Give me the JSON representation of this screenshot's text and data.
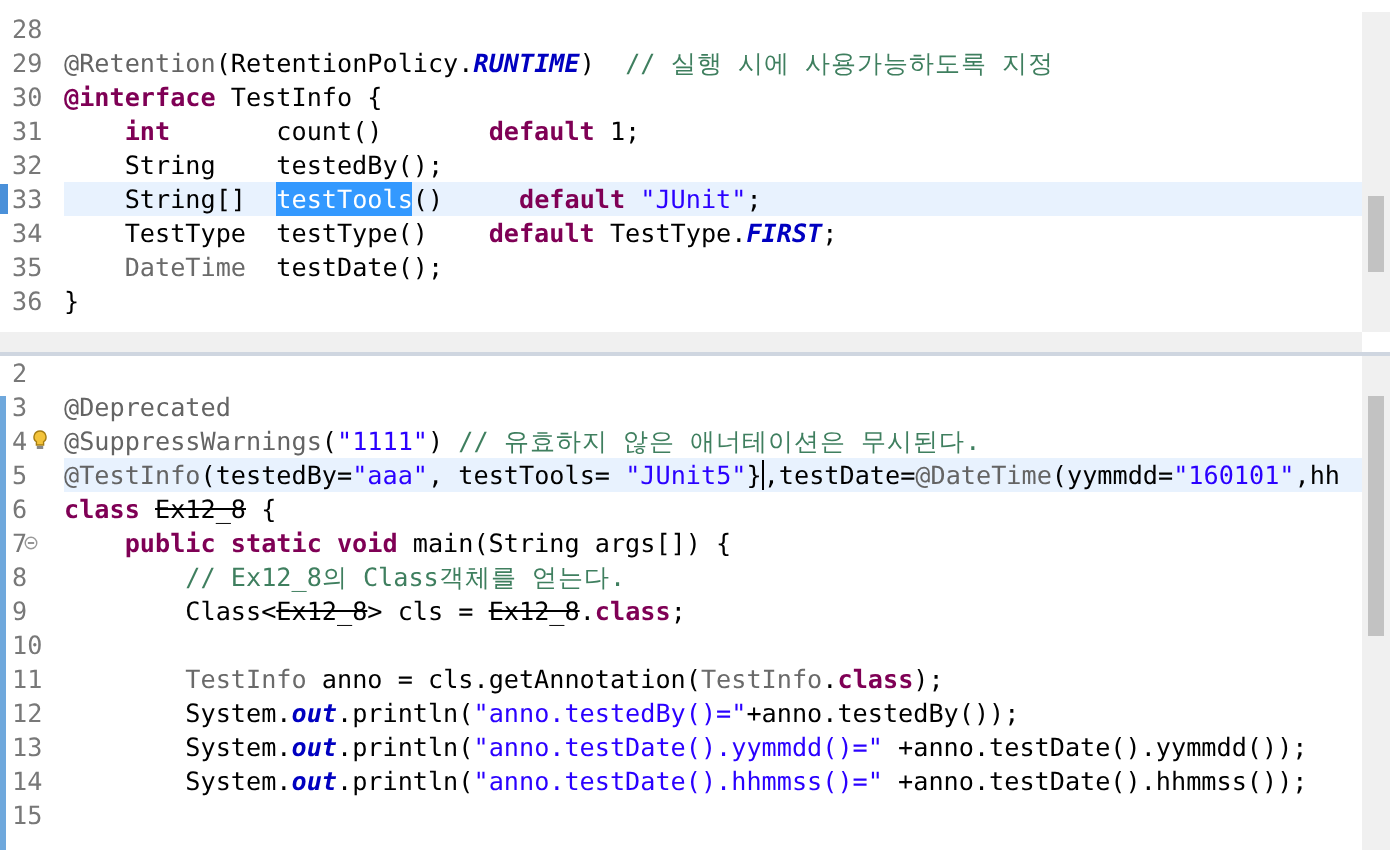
{
  "panes": [
    {
      "lines": [
        {
          "number": "28",
          "current": false
        },
        {
          "number": "29",
          "current": false,
          "tokens": [
            {
              "text": "@Retention",
              "kind": "annotation"
            },
            {
              "text": "(RetentionPolicy.",
              "kind": "plain"
            },
            {
              "text": "RUNTIME",
              "kind": "constant"
            },
            {
              "text": ")",
              "kind": "plain"
            },
            {
              "text": "  // 실행 시에 사용가능하도록 지정",
              "kind": "comment"
            }
          ]
        },
        {
          "number": "30",
          "current": false,
          "tokens": [
            {
              "text": "@interface",
              "kind": "keyword"
            },
            {
              "text": " TestInfo {",
              "kind": "plain"
            }
          ]
        },
        {
          "number": "31",
          "current": false,
          "tokens": [
            {
              "text": "    int",
              "kind": "keyword"
            },
            {
              "text": "       count()       ",
              "kind": "plain"
            },
            {
              "text": "default",
              "kind": "keyword"
            },
            {
              "text": " 1;",
              "kind": "plain"
            }
          ]
        },
        {
          "number": "32",
          "current": false,
          "tokens": [
            {
              "text": "    String    testedBy();",
              "kind": "plain"
            }
          ]
        },
        {
          "number": "33",
          "current": true,
          "tokens": [
            {
              "text": "    String[]  ",
              "kind": "plain"
            },
            {
              "text": "testTools",
              "kind": "selected"
            },
            {
              "text": "()     ",
              "kind": "plain"
            },
            {
              "text": "default",
              "kind": "keyword"
            },
            {
              "text": " \"JUnit\"",
              "kind": "string"
            },
            {
              "text": ";",
              "kind": "plain"
            }
          ]
        },
        {
          "number": "34",
          "current": false,
          "tokens": [
            {
              "text": "    TestType  testType()    ",
              "kind": "plain"
            },
            {
              "text": "default",
              "kind": "keyword"
            },
            {
              "text": " TestType.",
              "kind": "plain"
            },
            {
              "text": "FIRST",
              "kind": "constant"
            },
            {
              "text": ";",
              "kind": "plain"
            }
          ]
        },
        {
          "number": "35",
          "current": false,
          "tokens": [
            {
              "text": "    DateTime",
              "kind": "dim"
            },
            {
              "text": "  testDate();",
              "kind": "plain"
            }
          ]
        },
        {
          "number": "36",
          "current": false,
          "tokens": [
            {
              "text": "}",
              "kind": "plain"
            }
          ]
        }
      ]
    },
    {
      "lines": [
        {
          "number": "2",
          "current": false
        },
        {
          "number": "3",
          "current": false,
          "tokens": [
            {
              "text": "@Deprecated",
              "kind": "annotation"
            }
          ]
        },
        {
          "number": "4",
          "current": false,
          "kind": "warning",
          "tokens": [
            {
              "text": "@SuppressWarnings",
              "kind": "annotation"
            },
            {
              "text": "(",
              "kind": "plain"
            },
            {
              "text": "\"1111\"",
              "kind": "string"
            },
            {
              "text": ")",
              "kind": "plain"
            },
            {
              "text": " // 유효하지 않은 애너테이션은 무시된다.",
              "kind": "comment"
            }
          ]
        },
        {
          "number": "5",
          "current": true,
          "tokens": [
            {
              "text": "@TestInfo",
              "kind": "annotation"
            },
            {
              "text": "(testedBy=",
              "kind": "plain"
            },
            {
              "text": "\"aaa\"",
              "kind": "string"
            },
            {
              "text": ", testTools=",
              "kind": "plain"
            },
            {
              "text": " \"JUnit5\"",
              "kind": "string"
            },
            {
              "text": "}",
              "kind": "plain"
            },
            {
              "kind": "caret"
            },
            {
              "text": ",testDate=",
              "kind": "plain"
            },
            {
              "text": "@DateTime",
              "kind": "annotation"
            },
            {
              "text": "(yymmdd=",
              "kind": "plain"
            },
            {
              "text": "\"160101\"",
              "kind": "string"
            },
            {
              "text": ",hh",
              "kind": "plain"
            }
          ]
        },
        {
          "number": "6",
          "current": false,
          "tokens": [
            {
              "text": "class ",
              "kind": "keyword"
            },
            {
              "text": "Ex12_8",
              "kind": "deprecated"
            },
            {
              "text": " {",
              "kind": "plain"
            }
          ]
        },
        {
          "number": "7",
          "current": false,
          "kind": "fold",
          "tokens": [
            {
              "text": "    public static void",
              "kind": "keyword"
            },
            {
              "text": " main(String args[]) {",
              "kind": "plain"
            }
          ]
        },
        {
          "number": "8",
          "current": false,
          "tokens": [
            {
              "text": "        // Ex12_8의 Class객체를 얻는다.",
              "kind": "comment"
            }
          ]
        },
        {
          "number": "9",
          "current": false,
          "tokens": [
            {
              "text": "        Class<",
              "kind": "plain"
            },
            {
              "text": "Ex12_8",
              "kind": "deprecated"
            },
            {
              "text": "> cls = ",
              "kind": "plain"
            },
            {
              "text": "Ex12_8",
              "kind": "deprecated"
            },
            {
              "text": ".",
              "kind": "plain"
            },
            {
              "text": "class",
              "kind": "keyword"
            },
            {
              "text": ";",
              "kind": "plain"
            }
          ]
        },
        {
          "number": "10",
          "current": false
        },
        {
          "number": "11",
          "current": false,
          "tokens": [
            {
              "text": "        TestInfo",
              "kind": "dim"
            },
            {
              "text": " anno = cls.getAnnotation(",
              "kind": "plain"
            },
            {
              "text": "TestInfo",
              "kind": "dim"
            },
            {
              "text": ".",
              "kind": "plain"
            },
            {
              "text": "class",
              "kind": "keyword"
            },
            {
              "text": ");",
              "kind": "plain"
            }
          ]
        },
        {
          "number": "12",
          "current": false,
          "tokens": [
            {
              "text": "        System.",
              "kind": "plain"
            },
            {
              "text": "out",
              "kind": "static"
            },
            {
              "text": ".println(",
              "kind": "plain"
            },
            {
              "text": "\"anno.testedBy()=\"",
              "kind": "string"
            },
            {
              "text": "+anno.testedBy());",
              "kind": "plain"
            }
          ]
        },
        {
          "number": "13",
          "current": false,
          "tokens": [
            {
              "text": "        System.",
              "kind": "plain"
            },
            {
              "text": "out",
              "kind": "static"
            },
            {
              "text": ".println(",
              "kind": "plain"
            },
            {
              "text": "\"anno.testDate().yymmdd()=\"",
              "kind": "string"
            },
            {
              "text": " +anno.testDate().yymmdd());",
              "kind": "plain"
            }
          ]
        },
        {
          "number": "14",
          "current": false,
          "tokens": [
            {
              "text": "        System.",
              "kind": "plain"
            },
            {
              "text": "out",
              "kind": "static"
            },
            {
              "text": ".println(",
              "kind": "plain"
            },
            {
              "text": "\"anno.testDate().hhmmss()=\"",
              "kind": "string"
            },
            {
              "text": " +anno.testDate().hhmmss());",
              "kind": "plain"
            }
          ]
        },
        {
          "number": "15",
          "current": false
        }
      ]
    }
  ]
}
